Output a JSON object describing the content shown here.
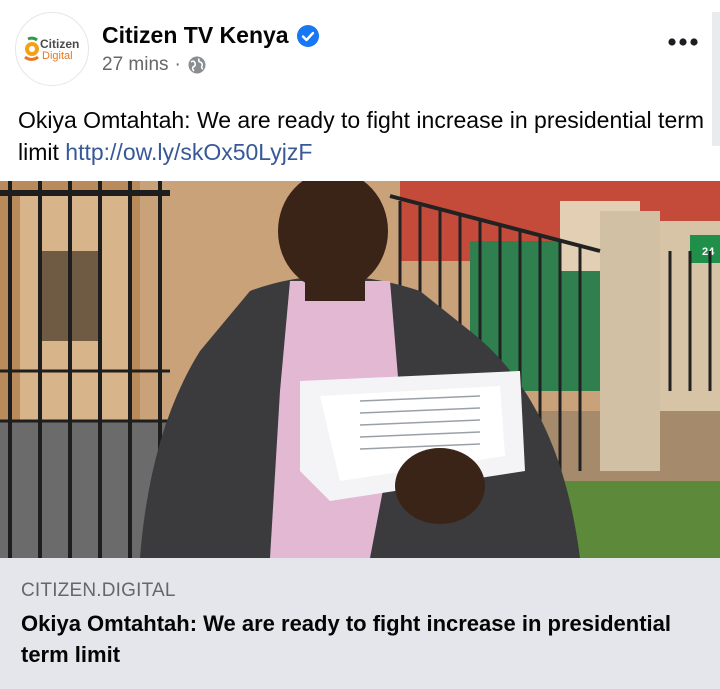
{
  "post": {
    "author": "Citizen TV Kenya",
    "timestamp": "27 mins",
    "separator": "·",
    "text": "Okiya Omtahtah: We are ready to fight increase in presidential term limit",
    "link_url": "http://ow.ly/skOx50LyjzF",
    "icons": {
      "verified": "verified-badge-icon",
      "privacy": "globe-icon",
      "more": "more-options-icon"
    }
  },
  "avatar": {
    "logo_line1": "Citizen",
    "logo_line2": "Digital"
  },
  "link_preview": {
    "domain": "CITIZEN.DIGITAL",
    "title": "Okiya Omtahtah: We are ready to fight increase in presidential term limit"
  },
  "photo": {
    "sign_text": "24"
  },
  "colors": {
    "verified": "#1877f2",
    "link": "#385898",
    "secondary_text": "#65676b",
    "card_background": "#e4e6eb"
  }
}
